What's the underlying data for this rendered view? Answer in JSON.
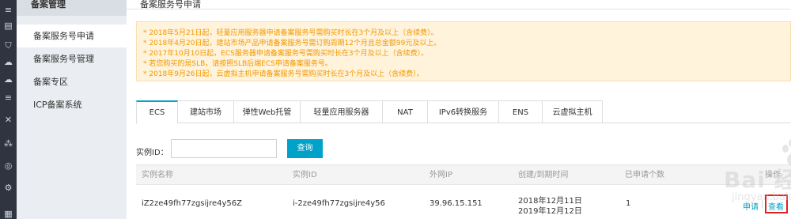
{
  "sidebar": {
    "header": "备案管理",
    "items": [
      {
        "label": "备案服务号申请"
      },
      {
        "label": "备案服务号管理"
      },
      {
        "label": "备案专区"
      },
      {
        "label": "ICP备案系统"
      }
    ]
  },
  "main": {
    "title": "备案服务号申请"
  },
  "notice": {
    "lines": [
      "* 2018年5月21日起，轻量应用服务器申请备案服务号需购买时长在3个月及以上（含续费）。",
      "* 2018年4月20日起，建站市场产品申请备案服务号需订购周期12个月且总金额99元及以上。",
      "* 2017年10月10日起，ECS服务器申请备案服务号需购买时长在3个月及以上（含续费）。",
      "* 若您购买的是SLB，请按照SLB后端ECS申请备案服务号。",
      "* 2018年9月26日起，云虚拟主机申请备案服务号需购买时长在3个月及以上（含续费）。"
    ],
    "color": "#f39800"
  },
  "tabs": [
    {
      "label": "ECS"
    },
    {
      "label": "建站市场"
    },
    {
      "label": "弹性Web托管"
    },
    {
      "label": "轻量应用服务器"
    },
    {
      "label": "NAT"
    },
    {
      "label": "IPv6转换服务"
    },
    {
      "label": "ENS"
    },
    {
      "label": "云虚拟主机"
    }
  ],
  "search": {
    "label": "实例ID：",
    "value": "",
    "button": "查询"
  },
  "table": {
    "headers": [
      "实例名称",
      "实例ID",
      "外网IP",
      "创建/到期时间",
      "已申请个数",
      "操作"
    ],
    "rows": [
      {
        "name": "iZ2ze49fh77zgsijre4y56Z",
        "id": "i-2ze49fh77zgsijre4y56",
        "ip": "39.96.15.151",
        "created": "2018年12月11日",
        "expires": "2019年12月12日",
        "count": "1",
        "action_apply": "申请",
        "action_view": "查看"
      }
    ]
  },
  "watermark": {
    "brand": "Bai 经验",
    "url": "jingyan.baidu.com"
  },
  "colors": {
    "accent": "#00a2ca",
    "highlight": "#e02020"
  }
}
